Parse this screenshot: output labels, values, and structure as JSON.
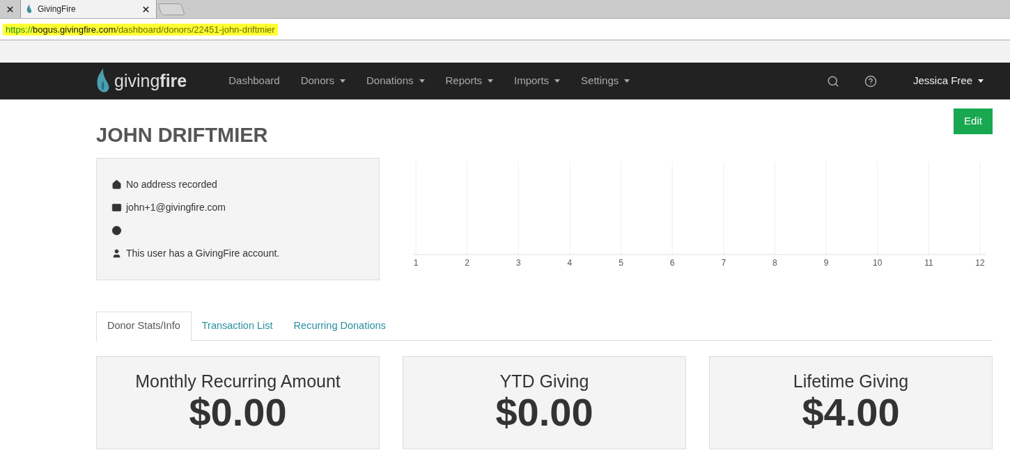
{
  "browser": {
    "tabs": [
      {
        "selected": false
      },
      {
        "title": "GivingFire",
        "selected": true
      }
    ],
    "url": [
      {
        "kind": "scheme",
        "text": "https://"
      },
      {
        "kind": "host",
        "text": "bogus.givingfire.com"
      },
      {
        "kind": "path",
        "text": "/dashboard/donors/22451-john-driftmier"
      }
    ]
  },
  "navbar": {
    "brand": {
      "light": "giving",
      "bold": "fire"
    },
    "items": [
      {
        "label": "Dashboard",
        "dropdown": false
      },
      {
        "label": "Donors",
        "dropdown": true
      },
      {
        "label": "Donations",
        "dropdown": true
      },
      {
        "label": "Reports",
        "dropdown": true
      },
      {
        "label": "Imports",
        "dropdown": true
      },
      {
        "label": "Settings",
        "dropdown": true
      }
    ],
    "user": "Jessica Free"
  },
  "edit_button": "Edit",
  "donor_name": "JOHN DRIFTMIER",
  "info": [
    {
      "kind": "address",
      "text": "No address recorded"
    },
    {
      "kind": "email",
      "text": "john+1@givingfire.com"
    },
    {
      "kind": "website"
    },
    {
      "kind": "account",
      "text": "This user has a GivingFire account."
    }
  ],
  "chart": {
    "x_labels": [
      "1",
      "2",
      "3",
      "4",
      "5",
      "6",
      "7",
      "8",
      "9",
      "10",
      "11",
      "12"
    ]
  },
  "tabs": [
    {
      "label": "Donor Stats/Info",
      "selected": true
    },
    {
      "label": "Transaction List",
      "selected": false
    },
    {
      "label": "Recurring Donations",
      "selected": false
    }
  ],
  "stats": [
    {
      "title": "Monthly Recurring Amount",
      "value": "$0.00"
    },
    {
      "title": "YTD Giving",
      "value": "$0.00"
    },
    {
      "title": "Lifetime Giving",
      "value": "$4.00"
    }
  ]
}
